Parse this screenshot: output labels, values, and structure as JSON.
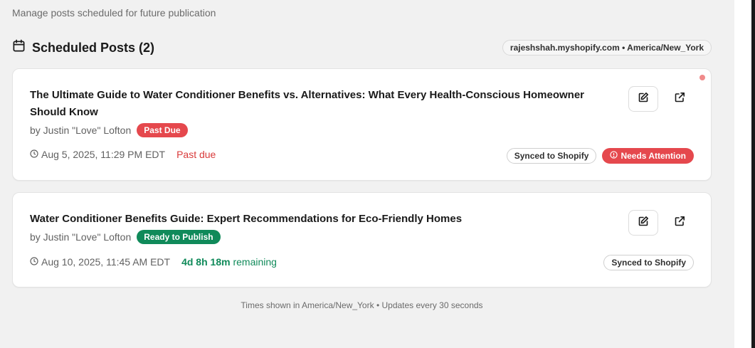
{
  "page": {
    "subtitle": "Manage posts scheduled for future publication",
    "section_title": "Scheduled Posts (2)",
    "store_info": "rajeshshah.myshopify.com • America/New_York",
    "footer": "Times shown in America/New_York • Updates every 30 seconds"
  },
  "posts": [
    {
      "title": "The Ultimate Guide to Water Conditioner Benefits vs. Alternatives: What Every Health-Conscious Homeowner Should Know",
      "author": "by Justin \"Love\" Lofton",
      "status_badge": "Past Due",
      "date": "Aug 5, 2025, 11:29 PM EDT",
      "status_text": "Past due",
      "sync_tag": "Synced to Shopify",
      "attention_tag": "Needs Attention"
    },
    {
      "title": "Water Conditioner Benefits Guide: Expert Recommendations for Eco-Friendly Homes",
      "author": "by Justin \"Love\" Lofton",
      "status_badge": "Ready to Publish",
      "date": "Aug 10, 2025, 11:45 AM EDT",
      "remaining_value": "4d 8h 18m",
      "remaining_label": "remaining",
      "sync_tag": "Synced to Shopify"
    }
  ],
  "icons": {
    "calendar": "calendar-icon",
    "clock": "clock-icon",
    "edit": "edit-icon",
    "external": "external-link-icon",
    "alert": "alert-circle-icon"
  },
  "colors": {
    "danger": "#e5484d",
    "success": "#108a5a",
    "background": "#f1f1f1"
  }
}
